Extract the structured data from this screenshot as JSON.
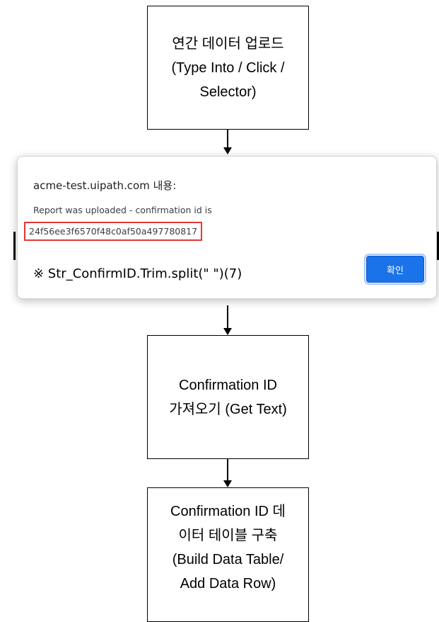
{
  "flowchart": {
    "steps": [
      {
        "text": "연간 데이터 업로드\n(Type Into / Click /\nSelector)"
      },
      {
        "text": "Confirmation ID\n가져오기 (Get Text)"
      },
      {
        "text": "Confirmation ID 데\n이터 테이블 구축\n(Build Data Table/\nAdd Data Row)"
      }
    ]
  },
  "dialog": {
    "title": "acme-test.uipath.com 내용:",
    "message": "Report was uploaded - confirmation id is",
    "confirmation_id": "24f56ee3f6570f48c0af50a497780817",
    "note": "※ Str_ConfirmID.Trim.split(\" \")(7)",
    "ok_label": "확인",
    "highlight_color": "#e53935",
    "button_color": "#1a73e8"
  }
}
